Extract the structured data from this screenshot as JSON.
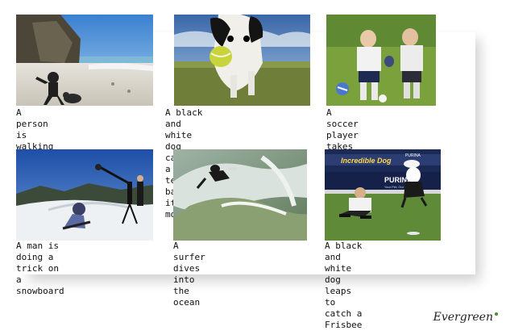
{
  "items": [
    {
      "caption": "A person is walking along a\nbeach with a big dog",
      "icon": "beach-scene"
    },
    {
      "caption": "A black and white dog carries\na tennis ball in its mouth",
      "icon": "dog-ball-scene"
    },
    {
      "caption": "A soccer player takes a\nsoccer ball in the grass",
      "icon": "soccer-scene"
    },
    {
      "caption": "A man is doing a trick on a\nsnowboard",
      "icon": "snowboard-scene"
    },
    {
      "caption": "A surfer dives into the\nocean",
      "icon": "surfer-scene"
    },
    {
      "caption": "A black and white dog\nleaps to catch a Frisbee",
      "icon": "frisbee-scene"
    }
  ],
  "frisbee_banner_text": "Incredible Dog",
  "frisbee_sign_text": "PURINA",
  "frisbee_small_text": "Your Pet, Our Passion.",
  "frisbee_top_text": "PURINA",
  "logo": "Evergreen"
}
